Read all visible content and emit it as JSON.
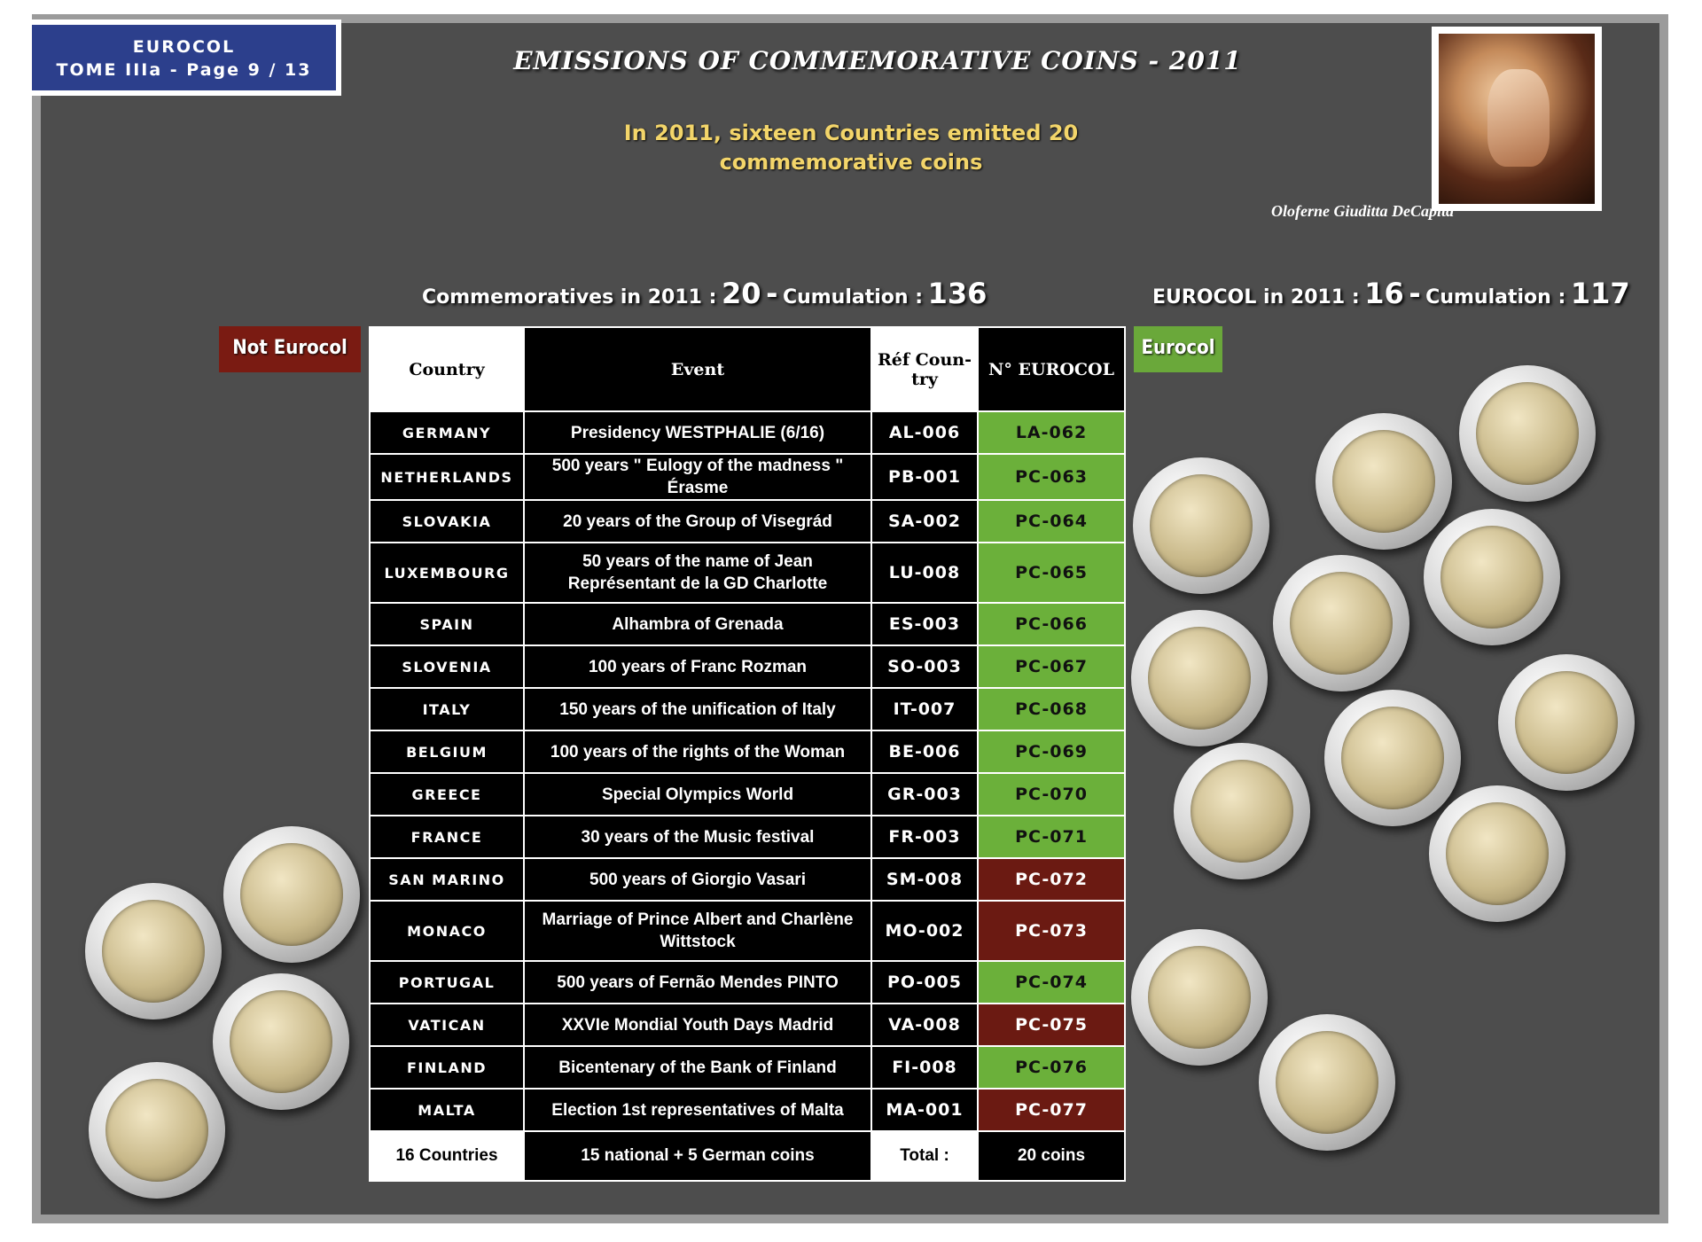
{
  "badge": {
    "line1": "EUROCOL",
    "line2": "TOME IIIa - Page 9  / 13"
  },
  "title": "EMISSIONS OF COMMEMORATIVE COINS - 2011",
  "subtitle": {
    "line1": "In 2011, sixteen Countries emitted 20",
    "line2": "commemorative coins"
  },
  "portrait_caption": "Oloferne Giuditta DeCapita",
  "stats": {
    "left": {
      "label1": "Commemoratives in 2011 :",
      "value1": "20",
      "dash": "-",
      "label2": "Cumulation :",
      "value2": "136"
    },
    "right": {
      "label1": "EUROCOL in 2011 :",
      "value1": "16",
      "dash": "-",
      "label2": "Cumulation :",
      "value2": "117"
    }
  },
  "tags": {
    "not_eurocol": "Not Eurocol",
    "eurocol": "Eurocol"
  },
  "colors": {
    "eurocol_green": "#6bb03a",
    "not_eurocol_red": "#6b1a12",
    "badge_blue": "#2c3f8c",
    "subtitle_gold": "#f3d56a"
  },
  "table": {
    "headers": {
      "country": "Country",
      "event": "Event",
      "ref": "Réf Coun-try",
      "num": "N° EUROCOL"
    },
    "rows": [
      {
        "country": "GERMANY",
        "event": "Presidency WESTPHALIE (6/16)",
        "ref": "AL-006",
        "num": "LA-062",
        "status": "green"
      },
      {
        "country": "NETHERLANDS",
        "event": "500 years \" Eulogy of the madness \" Érasme",
        "ref": "PB-001",
        "num": "PC-063",
        "status": "green"
      },
      {
        "country": "SLOVAKIA",
        "event": "20 years of the Group of Visegrád",
        "ref": "SA-002",
        "num": "PC-064",
        "status": "green"
      },
      {
        "country": "LUXEMBOURG",
        "event": "50 years of the name of Jean Représentant de la GD Charlotte",
        "ref": "LU-008",
        "num": "PC-065",
        "status": "green"
      },
      {
        "country": "SPAIN",
        "event": "Alhambra of Grenada",
        "ref": "ES-003",
        "num": "PC-066",
        "status": "green"
      },
      {
        "country": "SLOVENIA",
        "event": "100 years of Franc Rozman",
        "ref": "SO-003",
        "num": "PC-067",
        "status": "green"
      },
      {
        "country": "ITALY",
        "event": "150 years of the unification of Italy",
        "ref": "IT-007",
        "num": "PC-068",
        "status": "green"
      },
      {
        "country": "BELGIUM",
        "event": "100 years of the rights of the Woman",
        "ref": "BE-006",
        "num": "PC-069",
        "status": "green"
      },
      {
        "country": "GREECE",
        "event": "Special Olympics World",
        "ref": "GR-003",
        "num": "PC-070",
        "status": "green"
      },
      {
        "country": "FRANCE",
        "event": "30 years of the Music festival",
        "ref": "FR-003",
        "num": "PC-071",
        "status": "green"
      },
      {
        "country": "SAN MARINO",
        "event": "500 years of Giorgio Vasari",
        "ref": "SM-008",
        "num": "PC-072",
        "status": "red"
      },
      {
        "country": "MONACO",
        "event": "Marriage of Prince Albert and Charlène Wittstock",
        "ref": "MO-002",
        "num": "PC-073",
        "status": "red"
      },
      {
        "country": "PORTUGAL",
        "event": "500 years of Fernão Mendes PINTO",
        "ref": "PO-005",
        "num": "PC-074",
        "status": "green"
      },
      {
        "country": "VATICAN",
        "event": "XXVIe Mondial Youth Days Madrid",
        "ref": "VA-008",
        "num": "PC-075",
        "status": "red"
      },
      {
        "country": "FINLAND",
        "event": "Bicentenary of the Bank of Finland",
        "ref": "FI-008",
        "num": "PC-076",
        "status": "green"
      },
      {
        "country": "MALTA",
        "event": "Election 1st representatives of Malta",
        "ref": "MA-001",
        "num": "PC-077",
        "status": "red"
      }
    ],
    "footer": {
      "countries": "16 Countries",
      "coins": "15 national + 5 German coins",
      "total_label": "Total :",
      "total_value": "20 coins"
    }
  },
  "coin_images": {
    "not_eurocol": [
      "monaco-coin",
      "san-marino-coin",
      "vatican-coin",
      "malta-coin"
    ],
    "eurocol": [
      "germany-coin",
      "netherlands-coin",
      "slovakia-coin",
      "luxembourg-coin",
      "spain-coin",
      "slovenia-coin",
      "italy-coin",
      "belgium-coin",
      "greece-coin",
      "france-coin",
      "portugal-coin",
      "finland-coin"
    ]
  }
}
